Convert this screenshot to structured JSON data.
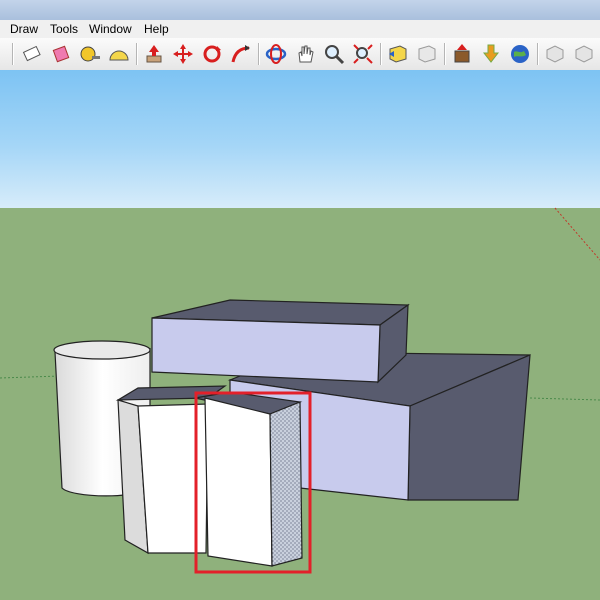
{
  "menu": {
    "items": [
      {
        "label": "Draw"
      },
      {
        "label": "Tools"
      },
      {
        "label": "Window"
      },
      {
        "label": "Help"
      }
    ]
  },
  "toolbar": {
    "tools": [
      "eraser-icon",
      "paint-bucket-icon",
      "tape-measure-icon",
      "protractor-icon",
      "push-pull-icon",
      "move-icon",
      "rotate-icon",
      "follow-me-icon",
      "orbit-icon",
      "pan-icon",
      "zoom-icon",
      "zoom-extents-icon",
      "previous-view-icon",
      "next-view-icon",
      "get-models-icon",
      "share-model-icon",
      "google-earth-icon",
      "components-icon",
      "component-icon-2"
    ]
  },
  "colors": {
    "sky_top": "#7dc3f3",
    "ground": "#8fb17c",
    "box_front": "#c8cbed",
    "box_top": "#585b6e",
    "selection": "#e3202a"
  },
  "scene": {
    "objects": [
      "cylinder",
      "upper-box",
      "lower-box",
      "folded-wall",
      "selected-face"
    ]
  }
}
